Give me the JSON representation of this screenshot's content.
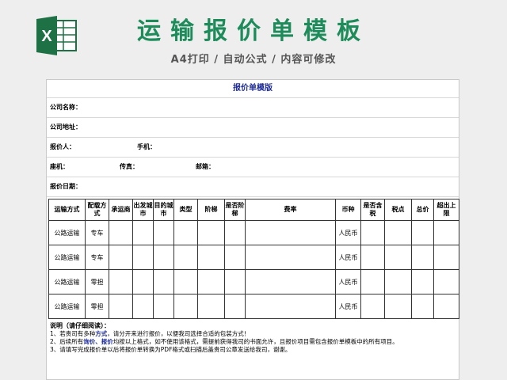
{
  "header": {
    "title": "运输报价单模板",
    "subtitle": "A4打印 / 自动公式 / 内容可修改",
    "logo_letter": "X",
    "logo_color": "#1e7145"
  },
  "sheet": {
    "title": "报价单模版",
    "fields": {
      "company_name": "公司名称：",
      "company_address": "公司地址：",
      "quoter": "报价人：",
      "mobile": "手机：",
      "landline": "座机：",
      "fax": "传真：",
      "email": "邮箱：",
      "quote_date": "报价日期："
    },
    "columns": [
      "运输方式",
      "配载方式",
      "承运商",
      "出发城市",
      "目的城市",
      "类型",
      "阶梯",
      "是否阶梯",
      "费率",
      "币种",
      "是否含税",
      "税点",
      "总价",
      "超出上限"
    ],
    "rows": [
      {
        "mode": "公路运输",
        "load": "专车",
        "currency": "人民币"
      },
      {
        "mode": "公路运输",
        "load": "专车",
        "currency": "人民币"
      },
      {
        "mode": "公路运输",
        "load": "零担",
        "currency": "人民币"
      },
      {
        "mode": "公路运输",
        "load": "零担",
        "currency": "人民币"
      }
    ],
    "notes": {
      "title": "说明（请仔细阅读）：",
      "line1_a": "1、若贵司有多种",
      "line1_b": "方式",
      "line1_c": "，请分开来进行报价，以便我司选择合适的包装方式！",
      "line2_a": "2、后续所有",
      "line2_b": "询价、报价",
      "line2_c": "均按以上格式，如不使用该格式，需提前获得我司的书面允许，且报价项目需包含报价单模板中的所有项目。",
      "line3": "3、请填写完成报价单以后将报价单转换为PDF格式或扫描后盖贵司公章发送给我司，谢谢。"
    }
  }
}
